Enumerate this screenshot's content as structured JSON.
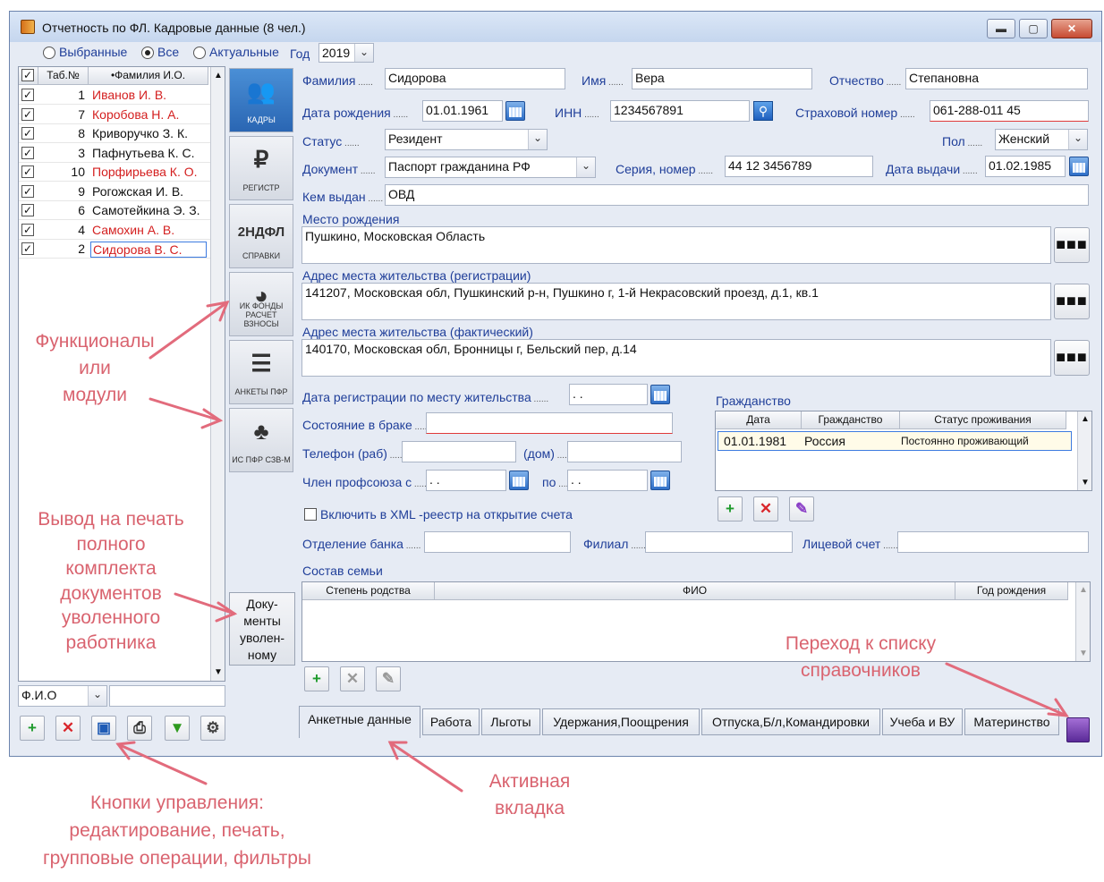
{
  "window": {
    "title": "Отчетность по ФЛ. Кадровые данные (8 чел.)"
  },
  "filters": {
    "selected": "Выбранные",
    "all": "Все",
    "actual": "Актуальные",
    "year_label": "Год",
    "year": "2019"
  },
  "employee_list": {
    "columns": [
      "Таб.№",
      "•Фамилия И.О."
    ],
    "rows": [
      {
        "num": "1",
        "name": "Иванов И. В.",
        "color": "#d42020"
      },
      {
        "num": "7",
        "name": "Коробова Н. А.",
        "color": "#d42020"
      },
      {
        "num": "8",
        "name": "Криворучко З. К.",
        "color": "#111111"
      },
      {
        "num": "3",
        "name": "Пафнутьева К. С.",
        "color": "#111111"
      },
      {
        "num": "10",
        "name": "Порфирьева К. О.",
        "color": "#d42020"
      },
      {
        "num": "9",
        "name": "Рогожская И. В.",
        "color": "#111111"
      },
      {
        "num": "6",
        "name": "Самотейкина Э. З.",
        "color": "#111111"
      },
      {
        "num": "4",
        "name": "Самохин А. В.",
        "color": "#d42020"
      },
      {
        "num": "2",
        "name": "Сидорова В. С.",
        "color": "#d42020"
      }
    ],
    "search_field": "Ф.И.О"
  },
  "modules": [
    {
      "label": "КАДРЫ",
      "icon": "people-icon",
      "glyph": "👥"
    },
    {
      "label": "РЕГИСТР",
      "icon": "ruble-icon",
      "glyph": "₽"
    },
    {
      "label": "СПРАВКИ",
      "icon": "ndfl-icon",
      "glyph": "2НДФЛ"
    },
    {
      "label": "ИК ФОНДЫ РАСЧЕТ ВЗНОСЫ",
      "icon": "pie-chart-icon",
      "glyph": "◕"
    },
    {
      "label": "АНКЕТЫ ПФР",
      "icon": "person-list-icon",
      "glyph": "☰"
    },
    {
      "label": "ИС ПФР СЗВ-М",
      "icon": "pfr-logo-icon",
      "glyph": "♣"
    }
  ],
  "fired_docs_button": {
    "line1": "Доку-",
    "line2": "менты",
    "line3": "уволен-",
    "line4": "ному"
  },
  "form": {
    "last_name_label": "Фамилия",
    "last_name": "Сидорова",
    "first_name_label": "Имя",
    "first_name": "Вера",
    "patronymic_label": "Отчество",
    "patronymic": "Степановна",
    "birth_date_label": "Дата рождения",
    "birth_date": "01.01.1961",
    "inn_label": "ИНН",
    "inn": "1234567891",
    "snils_label": "Страховой номер",
    "snils": "061-288-011 45",
    "status_label": "Статус",
    "status": "Резидент",
    "sex_label": "Пол",
    "sex": "Женский",
    "document_label": "Документ",
    "document": "Паспорт гражданина РФ",
    "series_label": "Серия, номер",
    "series": "44 12 3456789",
    "issue_date_label": "Дата выдачи",
    "issue_date": "01.02.1985",
    "issued_by_label": "Кем выдан",
    "issued_by": "ОВД",
    "birthplace_label": "Место рождения",
    "birthplace": "Пушкино, Московская Область",
    "reg_address_label": "Адрес места жительства (регистрации)",
    "reg_address": "141207, Московская обл, Пушкинский р-н, Пушкино г, 1-й Некрасовский проезд, д.1, кв.1",
    "fact_address_label": "Адрес места жительства (фактический)",
    "fact_address": "140170, Московская обл, Бронницы г, Бельский пер, д.14",
    "reg_date_label": "Дата регистрации по месту жительства",
    "reg_date": " .  .",
    "marital_label": "Состояние в браке",
    "phone_work_label": "Телефон (раб)",
    "phone_home_label": "(дом)",
    "union_label": "Член профсоюза с",
    "union_from": " .  .",
    "union_to_label": "по",
    "union_to": " .  .",
    "xml_label": "Включить в XML -реестр на открытие счета",
    "bank_label": "Отделение банка",
    "branch_label": "Филиал",
    "account_label": "Лицевой счет",
    "family_label": "Состав семьи"
  },
  "citizenship": {
    "title": "Гражданство",
    "columns": [
      "Дата",
      "Гражданство",
      "Статус проживания"
    ],
    "rows": [
      {
        "date": "01.01.1981",
        "country": "Россия",
        "status": "Постоянно проживающий"
      }
    ]
  },
  "family_table": {
    "columns": [
      "Степень родства",
      "ФИО",
      "Год рождения"
    ]
  },
  "tabs": [
    "Анкетные данные",
    "Работа",
    "Льготы",
    "Удержания,Поощрения",
    "Отпуска,Б/л,Командировки",
    "Учеба и ВУ",
    "Материнство"
  ],
  "annotations": {
    "modules": "Функционалы\nили\nмодули",
    "print": "Вывод на печать\nполного\nкомплекта\nдокументов\nуволенного\nработника",
    "refs": "Переход к списку\nсправочников",
    "active_tab": "Активная\nвкладка",
    "controls": "Кнопки управления:\nредактирование, печать,\nгрупповые операции, фильтры"
  }
}
